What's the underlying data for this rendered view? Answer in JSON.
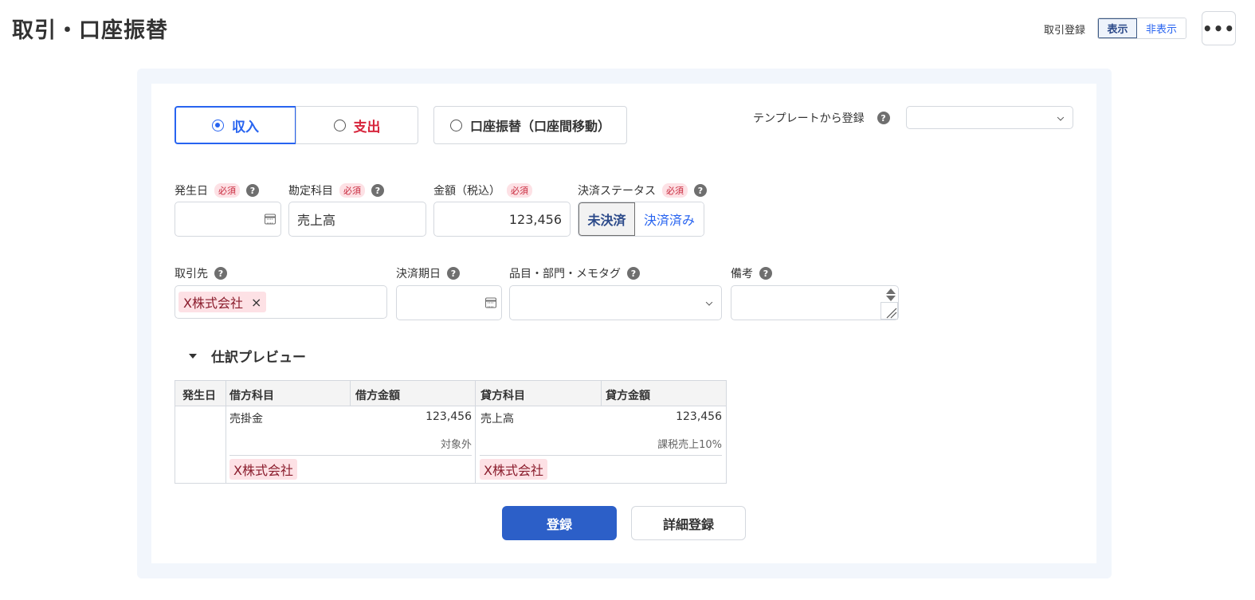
{
  "page": {
    "title": "取引・口座振替"
  },
  "header": {
    "register_label": "取引登録",
    "toggle": [
      "表示",
      "非表示"
    ],
    "toggle_selected": "表示",
    "more_label": "•••"
  },
  "type_selector": {
    "income": "収入",
    "expense": "支出",
    "transfer": "口座振替（口座間移動）",
    "selected": "収入"
  },
  "template": {
    "label": "テンプレートから登録",
    "value": ""
  },
  "fields": {
    "date": {
      "label": "発生日",
      "required": "必須",
      "value": ""
    },
    "account": {
      "label": "勘定科目",
      "required": "必須",
      "value": "売上高"
    },
    "amount": {
      "label": "金額（税込）",
      "required": "必須",
      "value": "123,456"
    },
    "status": {
      "label": "決済ステータス",
      "required": "必須",
      "options": [
        "未決済",
        "決済済み"
      ],
      "selected": "未決済"
    },
    "partner": {
      "label": "取引先",
      "tag": "X株式会社",
      "remove": "×"
    },
    "due_date": {
      "label": "決済期日",
      "value": ""
    },
    "items": {
      "label": "品目・部門・メモタグ",
      "value": ""
    },
    "memo": {
      "label": "備考",
      "value": ""
    }
  },
  "help_glyph": "?",
  "preview": {
    "title": "仕訳プレビュー",
    "headers": [
      "発生日",
      "借方科目",
      "借方金額",
      "貸方科目",
      "貸方金額"
    ],
    "debit": {
      "account": "売掛金",
      "amount": "123,456",
      "tax": "対象外",
      "tag": "X株式会社"
    },
    "credit": {
      "account": "売上高",
      "amount": "123,456",
      "tax": "課税売上10%",
      "tag": "X株式会社"
    }
  },
  "actions": {
    "register": "登録",
    "detailed_register": "詳細登録"
  },
  "colors": {
    "accent": "#2864f0",
    "primary_button": "#2c5fc8",
    "expense": "#d7263d",
    "required_bg": "#fde1e5",
    "panel_bg": "#f2f6fc"
  }
}
